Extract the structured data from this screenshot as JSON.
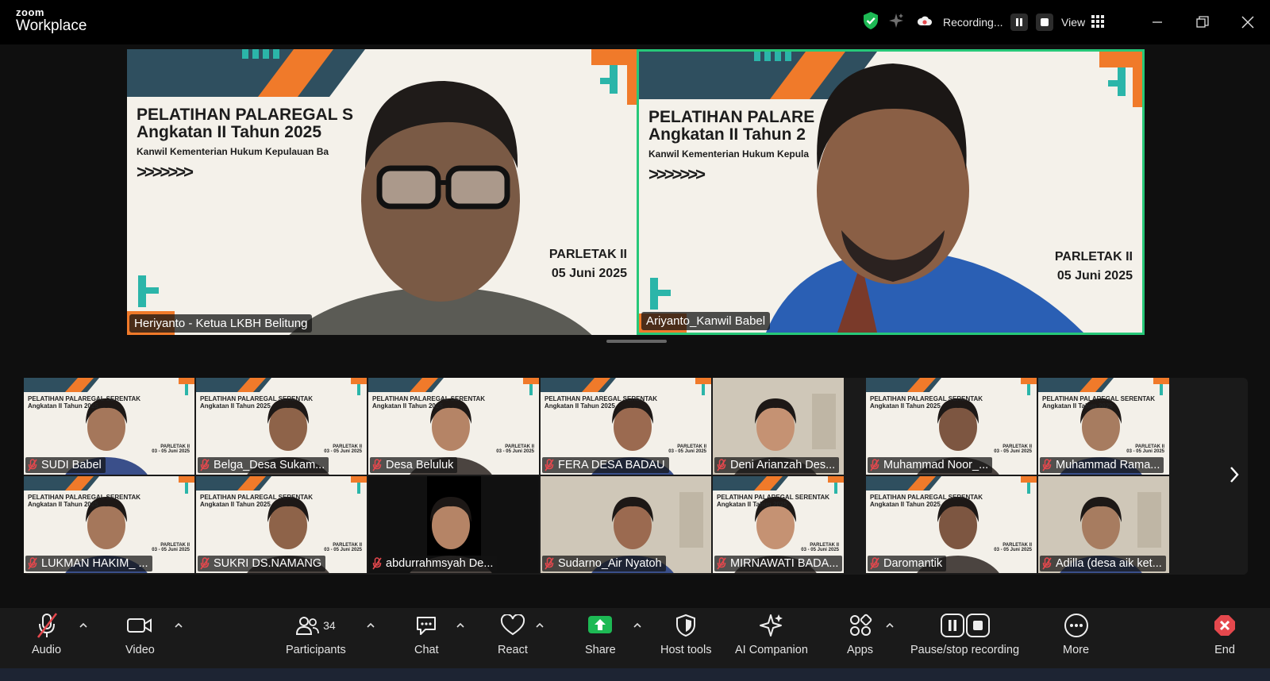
{
  "app": {
    "brand_top": "zoom",
    "brand_bottom": "Workplace"
  },
  "titlebar": {
    "recording_label": "Recording...",
    "view_label": "View"
  },
  "speakers": [
    {
      "name": "Heriyanto - Ketua LKBH Belitung",
      "slide_line1": "PELATIHAN PALAREGAL S",
      "slide_line2": "Angkatan II Tahun 2025",
      "slide_line3": "Kanwil Kementerian Hukum Kepulauan Ba",
      "slide_arrows": ">>>>>>>",
      "slide_event": "PARLETAK II",
      "slide_date": "05 Juni 2025",
      "active": false
    },
    {
      "name": "Ariyanto_Kanwil Babel",
      "slide_line1": "PELATIHAN PALARE",
      "slide_line2": "Angkatan II Tahun 2",
      "slide_line3": "Kanwil Kementerian Hukum Kepula",
      "slide_arrows": ">>>>>>>",
      "slide_event": "PARLETAK II",
      "slide_date": "05 Juni 2025",
      "active": true
    }
  ],
  "gallery": {
    "row1": [
      {
        "name": "SUDI Babel",
        "slide": true
      },
      {
        "name": "Belga_Desa Sukam...",
        "slide": true
      },
      {
        "name": "Desa Beluluk",
        "slide": true
      },
      {
        "name": "FERA DESA BADAU",
        "slide": true
      },
      {
        "name": "Deni Arianzah Des...",
        "slide": false
      },
      {
        "name": "Muhammad Noor_...",
        "slide": true
      },
      {
        "name": "Muhammad Rama...",
        "slide": true
      }
    ],
    "row2": [
      {
        "name": "LUKMAN HAKIM_ ...",
        "slide": true
      },
      {
        "name": "SUKRI DS.NAMANG",
        "slide": true
      },
      {
        "name": "abdurrahmsyah De...",
        "slide": false
      },
      {
        "name": "Sudarno_Air Nyatoh",
        "slide": false
      },
      {
        "name": "MIRNAWATI BADA...",
        "slide": true
      },
      {
        "name": "Daromantik",
        "slide": true
      },
      {
        "name": "Adilla (desa aik ket...",
        "slide": false
      }
    ],
    "mini_title_1": "PELATIHAN PALAREGAL SERENTAK",
    "mini_title_2": "Angkatan II Tahun 2025",
    "mini_event": "PARLETAK II",
    "mini_date": "03 - 05 Juni 2025"
  },
  "toolbar": {
    "audio": "Audio",
    "video": "Video",
    "participants": "Participants",
    "participants_count": "34",
    "chat": "Chat",
    "react": "React",
    "share": "Share",
    "host_tools": "Host tools",
    "ai_companion": "AI Companion",
    "apps": "Apps",
    "pause_stop": "Pause/stop recording",
    "more": "More",
    "end": "End"
  },
  "colors": {
    "active_speaker": "#27c879",
    "share_green": "#1db954",
    "end_red": "#e5484d",
    "mute_red": "#e5484d"
  }
}
